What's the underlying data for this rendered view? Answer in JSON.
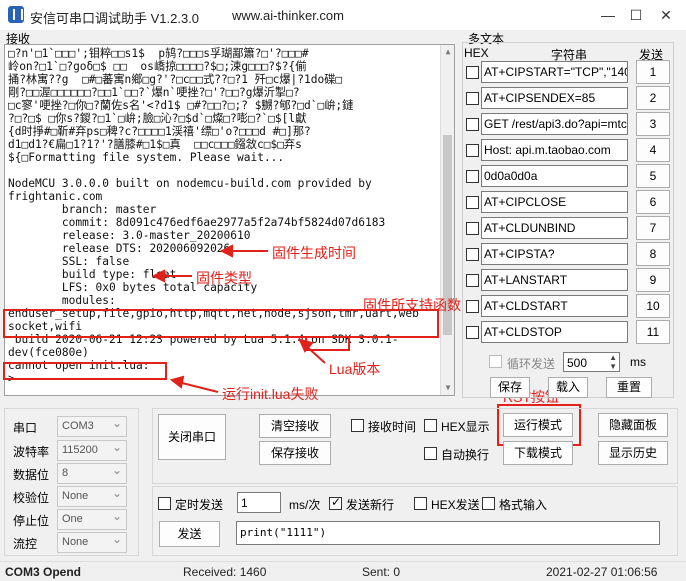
{
  "window": {
    "title": "安信可串口调试助手 V1.2.3.0",
    "url": "www.ai-thinker.com",
    "minimize": "—",
    "restore": "☐",
    "close": "✕"
  },
  "receive": {
    "section_label": "接收",
    "lines": [
      "□?n'□1`□□□';钼粹□□s1$  p鸫?□□□s孚瑚鄙簫?□'?□□□#",
      "岭on?□1`□?goδ□$ □□  os嶠掠□□□□?$□;涑g□□□?$?{偂",
      "捅?林寓??g  □#□蕃寓n鄉□g?'?□c□□式??□?1 歼□c爆|?1do碟□",
      "剛?□□渥□□□□□□?□□1`□□?`爆n`哽挫?□'?□□?g爆沂掣□?",
      "□c寥'哽挫?□你□?蘭佐s名'<?d1$ □#?□□?□;? $嬲?郇?□d`□峅;鏈",
      "?□?□$ □你s?鍐?□1`□峅;臉□沁?□$d`□燦□?嘭□?`□$[l獻",
      "{d时掙#□靳#弃ps□稗?c?□□□□1渓禧'缥□'o?□□□d #□]那?",
      "d1□d1?€扁□1?1?'?膳膝#□1$□真  □□c□□□鏹敜c□$□弃s",
      "${□Formatting file system. Please wait...",
      "",
      "NodeMCU 3.0.0.0 built on nodemcu-build.com provided by",
      "frightanic.com",
      "        branch: master",
      "        commit: 8d091c476edf6ae2977a5f2a74bf5824d07d6183",
      "        release: 3.0-master_20200610",
      "        release DTS: 202006092026",
      "        SSL: false",
      "        build type: float",
      "        LFS: 0x0 bytes total capacity",
      "        modules:",
      "enduser_setup,file,gpio,http,mqtt,net,node,sjson,tmr,uart,web",
      "socket,wifi",
      " build 2020-06-21 12:23 powered by Lua 5.1.4 on SDK 3.0.1-",
      "dev(fce080e)",
      "cannot open init.lua:",
      ">"
    ]
  },
  "annotations": {
    "build_time": "固件生成时间",
    "firmware_type": "固件类型",
    "modules": "固件所支持函数",
    "lua_version": "Lua版本",
    "init_fail": "运行init.lua失败",
    "rst": "RST按钮"
  },
  "multi": {
    "label": "多文本",
    "hex_header": "HEX",
    "str_header": "字符串",
    "send_header": "发送",
    "rows": [
      {
        "text": "AT+CIPSTART=\"TCP\",\"140",
        "num": "1"
      },
      {
        "text": "AT+CIPSENDEX=85",
        "num": "2"
      },
      {
        "text": "GET /rest/api3.do?api=mtc",
        "num": "3"
      },
      {
        "text": "Host: api.m.taobao.com",
        "num": "4"
      },
      {
        "text": "0d0a0d0a",
        "num": "5"
      },
      {
        "text": "AT+CIPCLOSE",
        "num": "6"
      },
      {
        "text": "AT+CLDUNBIND",
        "num": "7"
      },
      {
        "text": "AT+CIPSTA?",
        "num": "8"
      },
      {
        "text": "AT+LANSTART",
        "num": "9"
      },
      {
        "text": "AT+CLDSTART",
        "num": "10"
      },
      {
        "text": "AT+CLDSTOP",
        "num": "11"
      }
    ],
    "loop_label": "循环发送",
    "interval": "500",
    "ms": "ms",
    "save": "保存",
    "load": "载入",
    "reset": "重置"
  },
  "serial": {
    "port_label": "串口",
    "port": "COM3",
    "baud_label": "波特率",
    "baud": "115200",
    "data_label": "数据位",
    "data": "8",
    "parity_label": "校验位",
    "parity": "None",
    "stop_label": "停止位",
    "stop": "One",
    "flow_label": "流控",
    "flow": "None"
  },
  "controls": {
    "close_port": "关闭串口",
    "clear_recv": "清空接收",
    "save_recv": "保存接收",
    "recv_time": "接收时间",
    "hex_show": "HEX显示",
    "auto_wrap": "自动换行",
    "run_mode": "运行模式",
    "download_mode": "下载模式",
    "hide_panel": "隐藏面板",
    "show_history": "显示历史",
    "timed_send": "定时发送",
    "period": "1",
    "ms_per": "ms/次",
    "send_newline": "发送新行",
    "hex_send": "HEX发送",
    "format_input": "格式输入",
    "send": "发送",
    "send_text": "print(\"1111\")"
  },
  "status": {
    "port": "COM3 Opend",
    "received": "Received: 1460",
    "sent": "Sent: 0",
    "datetime": "2021-02-27 01:06:56"
  }
}
